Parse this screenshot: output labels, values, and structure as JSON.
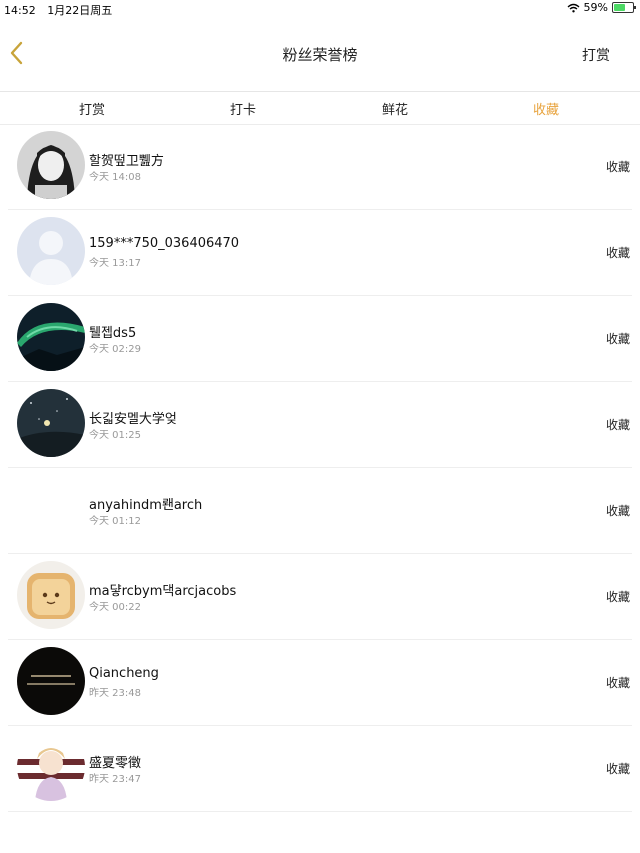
{
  "status_bar": {
    "time": "14:52",
    "date": "1月22日周五",
    "battery": "59%",
    "battery_level": 0.59
  },
  "nav": {
    "title": "粉丝荣誉榜",
    "action": "打赏",
    "back_icon": "chevron-left-icon",
    "accent": "#c8a43a"
  },
  "tabs": [
    {
      "label": "打赏",
      "active": false
    },
    {
      "label": "打卡",
      "active": false
    },
    {
      "label": "鲜花",
      "active": false
    },
    {
      "label": "收藏",
      "active": true
    }
  ],
  "active_color": "#e8a33d",
  "fans": [
    {
      "name": "할贺떺卫쀒方",
      "time": "今天 14:08",
      "action": "收藏"
    },
    {
      "name": "159***750_036406470",
      "time": "今天 13:17",
      "action": "收藏"
    },
    {
      "name": "퉬젭ds5",
      "time": "今天 02:29",
      "action": "收藏"
    },
    {
      "name": "长긻安멜大学엊",
      "time": "今天 01:25",
      "action": "收藏"
    },
    {
      "name": "anyahindm뢘arch",
      "time": "今天 01:12",
      "action": "收藏"
    },
    {
      "name": "ma댷rcbym댁arcjacobs",
      "time": "今天 00:22",
      "action": "收藏"
    },
    {
      "name": "Qiancheng",
      "time": "昨天 23:48",
      "action": "收藏"
    },
    {
      "name": "盛夏零徵",
      "time": "昨天 23:47",
      "action": "收藏"
    }
  ]
}
